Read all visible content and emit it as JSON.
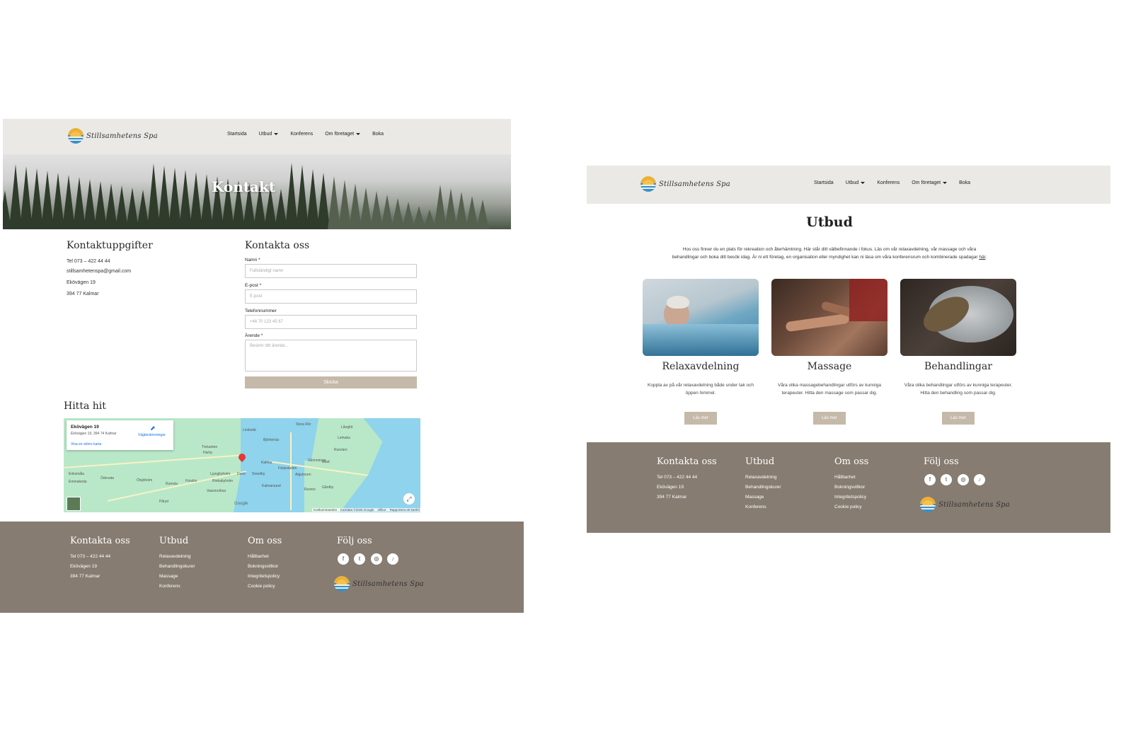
{
  "brand": {
    "logo_text": "Stillsamhetens Spa"
  },
  "nav": {
    "items": [
      "Startsida",
      "Utbud",
      "Konferens",
      "Om företaget",
      "Boka"
    ]
  },
  "kontakt_page": {
    "hero_title": "Kontakt",
    "info": {
      "heading": "Kontaktuppgifter",
      "phone": "Tel 073 – 422 44 44",
      "email": "stillsamhetenspa@gmail.com",
      "street": "Ekövägen 19",
      "city": "394 77 Kalmar"
    },
    "form": {
      "heading": "Kontakta oss",
      "name_label": "Namn *",
      "name_placeholder": "Fullständigt namn",
      "email_label": "E-post *",
      "email_placeholder": "E-post",
      "phone_label": "Telefonnummer",
      "phone_placeholder": "+46 70 123 45 67",
      "subject_label": "Ärende *",
      "subject_placeholder": "Beskriv ditt ärende...",
      "submit": "Skicka"
    },
    "map": {
      "heading": "Hitta hit",
      "card_title": "Ekövägen 19",
      "card_address": "Ekövägen 19, 394 74 Kalmar",
      "directions": "Vägbeskrivningar",
      "bigger_map": "Visa en större karta",
      "places": [
        "Lindsdal",
        "Björkenäs",
        "Trekanten",
        "Hartiy",
        "Ljungbyholm",
        "Rinkabyholm",
        "Kalmar",
        "Dunö",
        "Smedby",
        "Vassmolösa",
        "Rumsla",
        "Påryd",
        "Färjestaden",
        "Algutsrum",
        "Glömminge",
        "Stora Rör",
        "Långlöt",
        "Runsten",
        "Resmo",
        "Gårdby",
        "Ölsjöholm",
        "Ödevata",
        "Emmaboda",
        "Eriksmåla",
        "Förslöv",
        "Kalmarsund",
        "Lerkaka",
        "Glad"
      ],
      "attribution": [
        "Kortkommandon",
        "Kartdata ©2025 Google",
        "Villkor",
        "Rapportera ett kartfel"
      ],
      "google": "Google"
    }
  },
  "utbud_page": {
    "title": "Utbud",
    "intro_line1": "Hos oss finner du en plats för rekreation och återhämtning. Här står ditt välbefinnande i fokus. Läs om vår relaxavdelning, vår massage och våra",
    "intro_line2": "behandlingar och boka ditt besök idag. Är ni ett företag, en organisation eller myndighet kan ni läsa om våra konferensrum och kombinerade spadagar",
    "intro_link": "här",
    "cards": [
      {
        "title": "Relaxavdelning",
        "text": "Koppla av på vår relaxavdelning både under tak och öppen himmel.",
        "button": "Läs mer"
      },
      {
        "title": "Massage",
        "text": "Våra olika massagebehandlingar utförs av kunniga terapeuter. Hitta den massage som passar dig.",
        "button": "Läs mer"
      },
      {
        "title": "Behandlingar",
        "text": "Våra olika behandlingar utförs av kunniga terapeuter. Hitta den behandling som passar dig.",
        "button": "Läs mer"
      }
    ]
  },
  "footer": {
    "contact_heading": "Kontakta oss",
    "phone": "Tel 073 – 422 44 44",
    "street": "Ekövägen 19",
    "city": "394 77 Kalmar",
    "utbud_heading": "Utbud",
    "utbud_links": [
      "Relaxavdelning",
      "Behandlingskurer",
      "Massage",
      "Konferens"
    ],
    "om_heading": "Om oss",
    "om_links": [
      "Hållbarhet",
      "Bokningsvillkor",
      "Integritetspolicy",
      "Cookie policy"
    ],
    "follow_heading": "Följ oss",
    "social": [
      "facebook-icon",
      "twitter-icon",
      "instagram-icon",
      "tiktok-icon"
    ]
  },
  "colors": {
    "header_bg": "#ebe9e5",
    "footer_bg": "#877c71",
    "button": "#c5b9a9"
  }
}
